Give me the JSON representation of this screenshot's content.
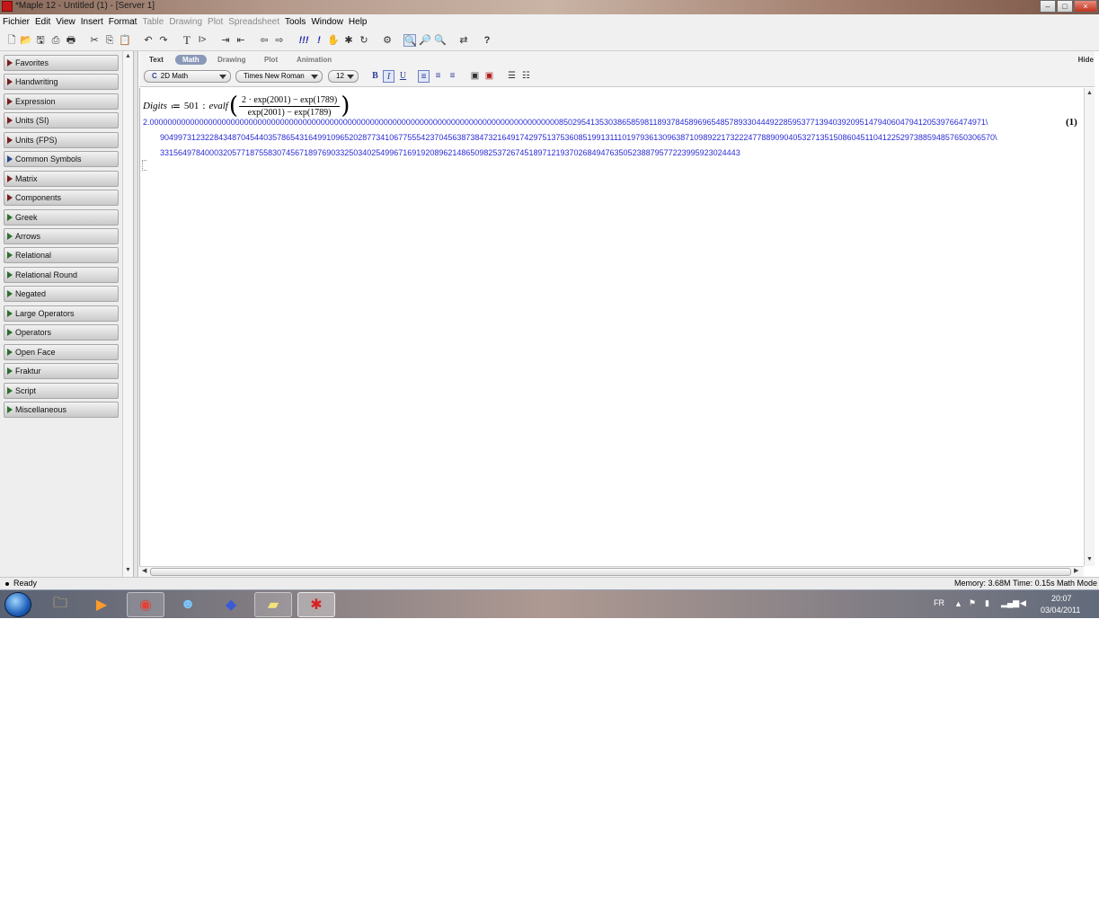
{
  "window": {
    "title": "*Maple 12 - Untitled (1) - [Server 1]",
    "controls": {
      "minimize": "–",
      "maximize": "□",
      "close": "×"
    }
  },
  "menubar": {
    "items": [
      {
        "label": "Fichier",
        "enabled": true
      },
      {
        "label": "Edit",
        "enabled": true
      },
      {
        "label": "View",
        "enabled": true
      },
      {
        "label": "Insert",
        "enabled": true
      },
      {
        "label": "Format",
        "enabled": true
      },
      {
        "label": "Table",
        "enabled": false
      },
      {
        "label": "Drawing",
        "enabled": false
      },
      {
        "label": "Plot",
        "enabled": false
      },
      {
        "label": "Spreadsheet",
        "enabled": false
      },
      {
        "label": "Tools",
        "enabled": true
      },
      {
        "label": "Window",
        "enabled": true
      },
      {
        "label": "Help",
        "enabled": true
      }
    ]
  },
  "toolbar": {
    "icons": [
      "new-document-icon",
      "open-icon",
      "save-icon",
      "print-icon",
      "print-preview-icon",
      "cut-icon",
      "copy-icon",
      "paste-icon",
      "undo-icon",
      "redo-icon",
      "text-mode-icon",
      "math-mode-icon",
      "indent-icon",
      "outdent-icon",
      "back-icon",
      "forward-icon",
      "execute-all-icon",
      "execute-icon",
      "stop-icon",
      "debug-icon",
      "restart-icon",
      "settings-icon",
      "zoom-100-icon",
      "zoom-in-icon",
      "zoom-out-icon",
      "toggle-icon",
      "help-icon"
    ],
    "glyphs": {
      "new": "🗋",
      "open": "📂",
      "save": "🖫",
      "print": "⎙",
      "preview": "🖶",
      "cut": "✂",
      "copy": "⎘",
      "paste": "📋",
      "undo": "↶",
      "redo": "↷",
      "text": "T",
      "math": "I>",
      "indent": "⇥",
      "outdent": "⇤",
      "back": "⇦",
      "forward": "⇨",
      "execute_all": "!!!",
      "execute": "!",
      "stop": "✋",
      "debug": "✱",
      "restart": "↻",
      "settings": "⚙",
      "zoom100": "🔍",
      "zoomin": "🔎",
      "zoomout": "🔍",
      "toggle": "⇄",
      "help": "?"
    }
  },
  "palettes": {
    "items": [
      {
        "label": "Favorites",
        "color": "red"
      },
      {
        "label": "Handwriting",
        "color": "red"
      },
      {
        "label": "Expression",
        "color": "red"
      },
      {
        "label": "Units (SI)",
        "color": "red"
      },
      {
        "label": "Units (FPS)",
        "color": "red"
      },
      {
        "label": "Common Symbols",
        "color": "blue"
      },
      {
        "label": "Matrix",
        "color": "red"
      },
      {
        "label": "Components",
        "color": "red"
      },
      {
        "label": "Greek",
        "color": "green"
      },
      {
        "label": "Arrows",
        "color": "green"
      },
      {
        "label": "Relational",
        "color": "green"
      },
      {
        "label": "Relational Round",
        "color": "green"
      },
      {
        "label": "Negated",
        "color": "green"
      },
      {
        "label": "Large Operators",
        "color": "green"
      },
      {
        "label": "Operators",
        "color": "green"
      },
      {
        "label": "Open Face",
        "color": "green"
      },
      {
        "label": "Fraktur",
        "color": "green"
      },
      {
        "label": "Script",
        "color": "green"
      },
      {
        "label": "Miscellaneous",
        "color": "green"
      }
    ]
  },
  "context_bar": {
    "tabs": [
      "Text",
      "Math",
      "Drawing",
      "Plot",
      "Animation"
    ],
    "active_tab": "Math",
    "hide_label": "Hide",
    "mode_select": "2D Math",
    "mode_select_prefix": "C",
    "font_select": "Times New Roman",
    "size_select": "12",
    "bold": "B",
    "italic": "I",
    "underline": "U"
  },
  "worksheet": {
    "input": {
      "lhs": "Digits",
      "assign": "≔",
      "digits_value": "501",
      "sep": ":",
      "func": "evalf",
      "numerator": "2 · exp(2001) − exp(1789)",
      "denominator": "exp(2001) − exp(1789)"
    },
    "output_lines": [
      "2.000000000000000000000000000000000000000000000000000000000000000000000000000000000000000000085029541353038658598118937845896965485789330444922859537713940392095147940604794120539766474971\\",
      "904997312322843487045440357865431649910965202877341067755542370456387384732164917429751375360851991311101979361309638710989221732224778890904053271351508604511041225297388594857650306570\\",
      "331564978400032057718755830745671897690332503402549967169192089621486509825372674518971219370268494763505238879577223995923024443"
    ],
    "equation_label": "(1)"
  },
  "status": {
    "state": "Ready",
    "memory": "Memory: 3.68M",
    "time": "Time: 0.15s",
    "mode": "Math Mode"
  },
  "taskbar": {
    "apps": [
      "explorer-icon",
      "media-player-icon",
      "chrome-icon",
      "messenger-icon",
      "cube-app-icon",
      "sticky-notes-icon",
      "maple-icon"
    ],
    "language": "FR",
    "clock_time": "20:07",
    "clock_date": "03/04/2011"
  },
  "colors": {
    "output_blue": "#2b2bd6",
    "active_tab": "#8a99b8"
  }
}
